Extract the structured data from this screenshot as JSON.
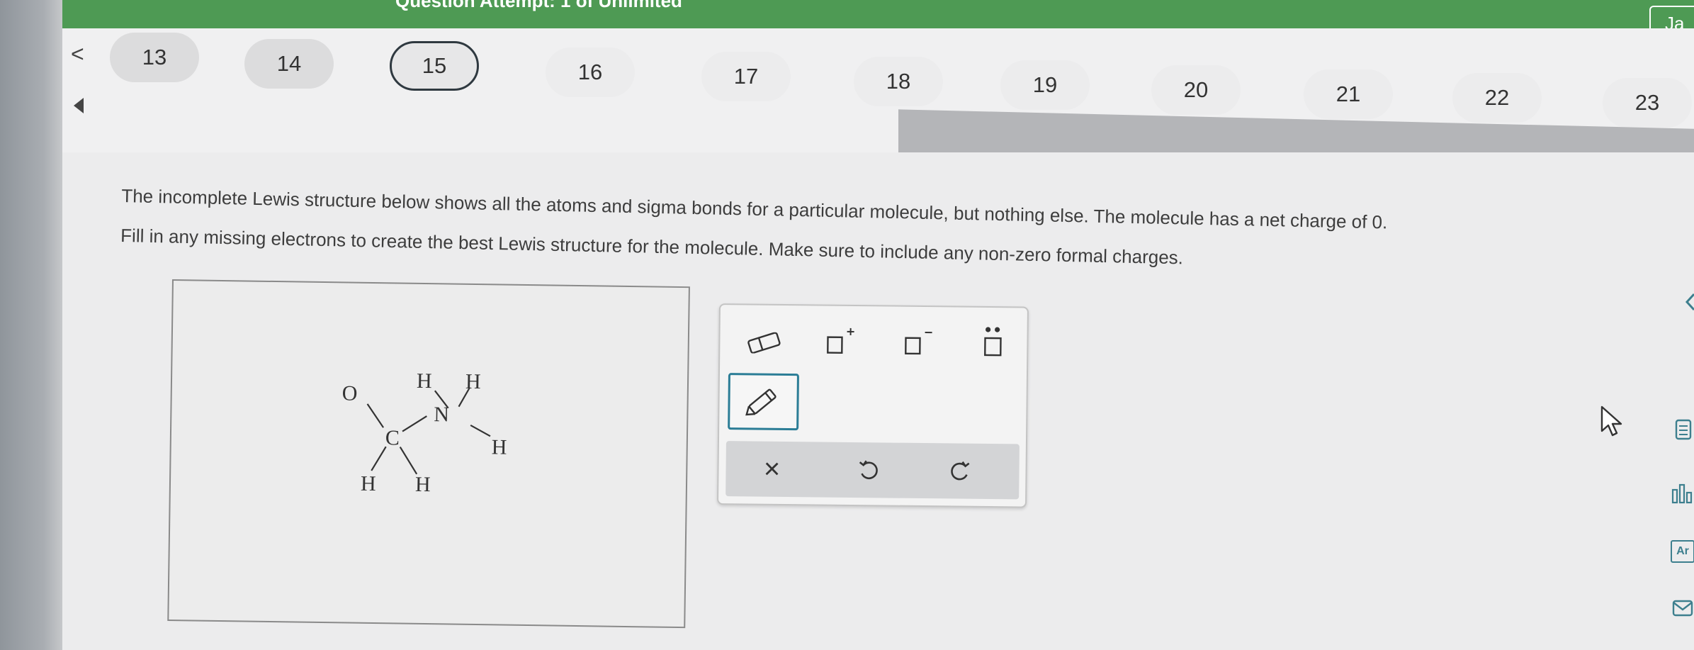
{
  "header": {
    "attempt_text": "Question Attempt: 1 of Unlimited",
    "user_badge": "Ja"
  },
  "nav": {
    "prev_label": "<",
    "questions": [
      {
        "label": "13"
      },
      {
        "label": "14"
      },
      {
        "label": "15"
      },
      {
        "label": "16"
      },
      {
        "label": "17"
      },
      {
        "label": "18"
      },
      {
        "label": "19"
      },
      {
        "label": "20"
      },
      {
        "label": "21"
      },
      {
        "label": "22"
      },
      {
        "label": "23"
      }
    ],
    "current": "15"
  },
  "question": {
    "line1": "The incomplete Lewis structure below shows all the atoms and sigma bonds for a particular molecule, but nothing else. The molecule has a net charge of 0.",
    "line2": "Fill in any missing electrons to create the best Lewis structure for the molecule. Make sure to include any non-zero formal charges."
  },
  "structure": {
    "atoms": {
      "O": "O",
      "C": "C",
      "N": "N",
      "H_n1": "H",
      "H_n2": "H",
      "H_n3": "H",
      "H_c1": "H",
      "H_c2": "H"
    }
  },
  "toolbar": {
    "eraser_icon": "eraser-icon",
    "positive_charge_icon": "positive-charge-icon",
    "negative_charge_icon": "negative-charge-icon",
    "lone_pair_icon": "lone-pair-icon",
    "pencil_icon": "pencil-icon",
    "clear_label": "×",
    "undo_icon": "undo-icon",
    "redo_icon": "redo-icon",
    "accent": "#2b7d96"
  },
  "side_tools": {
    "answer_icon": "answer-icon",
    "chart_icon": "chart-icon",
    "periodic_table_label": "Ar",
    "mail_icon": "mail-icon"
  },
  "colors": {
    "header_green": "#4e9a54",
    "accent_teal": "#2b7d96"
  }
}
